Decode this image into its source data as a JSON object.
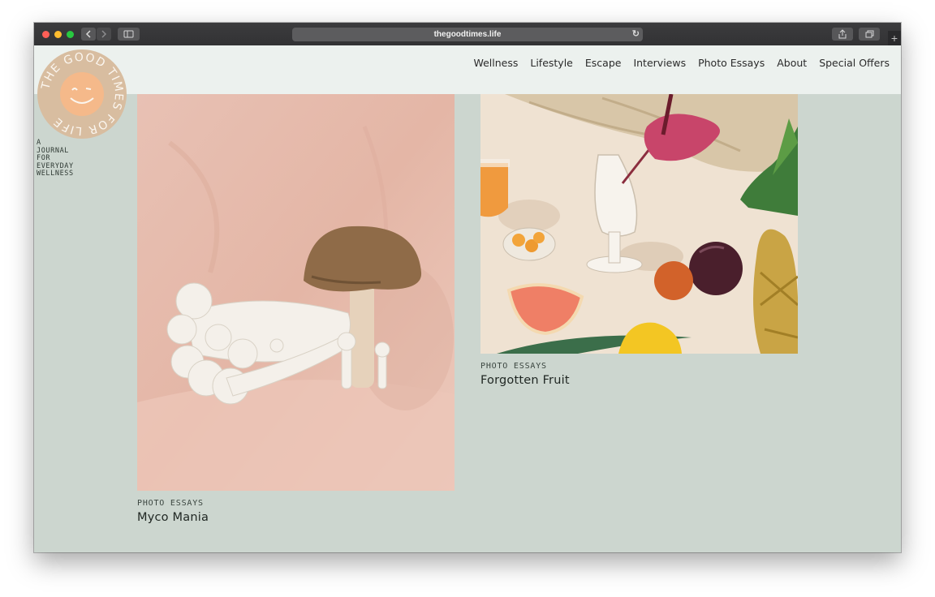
{
  "browser": {
    "url": "thegoodtimes.life",
    "back_icon": "chevron-left-icon",
    "forward_icon": "chevron-right-icon",
    "sidebar_icon": "sidebar-icon",
    "reload_icon": "reload-icon",
    "share_icon": "share-icon",
    "tabs_icon": "tabs-icon",
    "new_tab_label": "+"
  },
  "site": {
    "logo_text": "THE GOOD TIMES FOR LIFE",
    "tagline_lines": [
      "A",
      "JOURNAL",
      "FOR",
      "EVERYDAY",
      "WELLNESS"
    ],
    "colors": {
      "background": "#ccd6cf",
      "header": "#ecf1ee",
      "logo": "#d8bda0",
      "logo_face": "#f5b98a"
    }
  },
  "nav": {
    "items": [
      "Wellness",
      "Lifestyle",
      "Escape",
      "Interviews",
      "Photo Essays",
      "About",
      "Special Offers"
    ]
  },
  "articles": [
    {
      "category": "PHOTO ESSAYS",
      "title": "Myco Mania"
    },
    {
      "category": "PHOTO ESSAYS",
      "title": "Forgotten Fruit"
    }
  ]
}
